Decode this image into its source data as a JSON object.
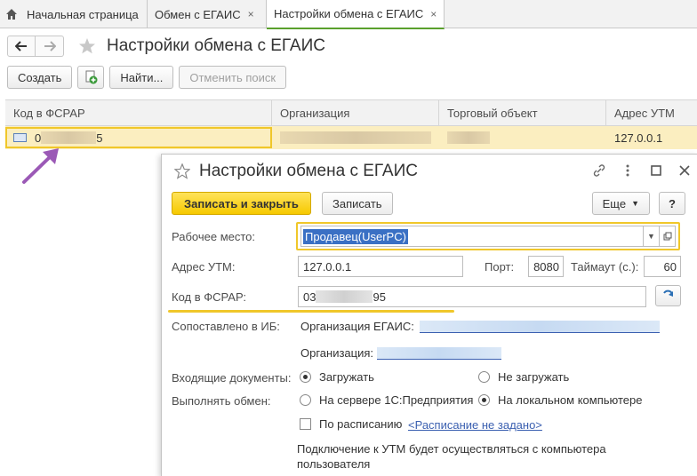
{
  "tabs": [
    {
      "label": "Начальная страница"
    },
    {
      "label": "Обмен с ЕГАИС",
      "close": "×"
    },
    {
      "label": "Настройки обмена с ЕГАИС",
      "close": "×"
    }
  ],
  "page": {
    "title": "Настройки обмена с ЕГАИС"
  },
  "toolbar": {
    "create": "Создать",
    "find": "Найти...",
    "cancel_search": "Отменить поиск"
  },
  "grid": {
    "columns": [
      "Код в ФСРАР",
      "Организация",
      "Торговый объект",
      "Адрес УТМ"
    ],
    "row": {
      "code_start": "0",
      "code_end": "5",
      "utm": "127.0.0.1"
    }
  },
  "dialog": {
    "title": "Настройки обмена с ЕГАИС",
    "save_close": "Записать и закрыть",
    "save": "Записать",
    "more": "Еще",
    "help": "?",
    "workplace_label": "Рабочее место:",
    "workplace_value": "Продавец(UserPC)",
    "utm_label": "Адрес УТМ:",
    "utm_value": "127.0.0.1",
    "port_label": "Порт:",
    "port_value": "8080",
    "timeout_label": "Таймаут (с.):",
    "timeout_value": "60",
    "fsrar_label": "Код в ФСРАР:",
    "fsrar_start": "03",
    "fsrar_end": "95",
    "mapped_label": "Сопоставлено в ИБ:",
    "org_egais_label": "Организация ЕГАИС:",
    "org_label": "Организация:",
    "incoming_label": "Входящие документы:",
    "incoming_load": "Загружать",
    "incoming_noload": "Не загружать",
    "exchange_label": "Выполнять обмен:",
    "exchange_server": "На сервере 1С:Предприятия",
    "exchange_local": "На локальном компьютере",
    "schedule_label": "По расписанию",
    "schedule_link": "<Расписание не задано>",
    "note": "Подключение к УТМ будет осуществляться с компьютера пользователя"
  },
  "colors": {
    "accent_yellow": "#f0c72a",
    "primary_btn": "#f6c900",
    "row_highlight": "#fbeec0",
    "active_tab_underline": "#5aa02c",
    "arrow": "#9b59b6"
  }
}
